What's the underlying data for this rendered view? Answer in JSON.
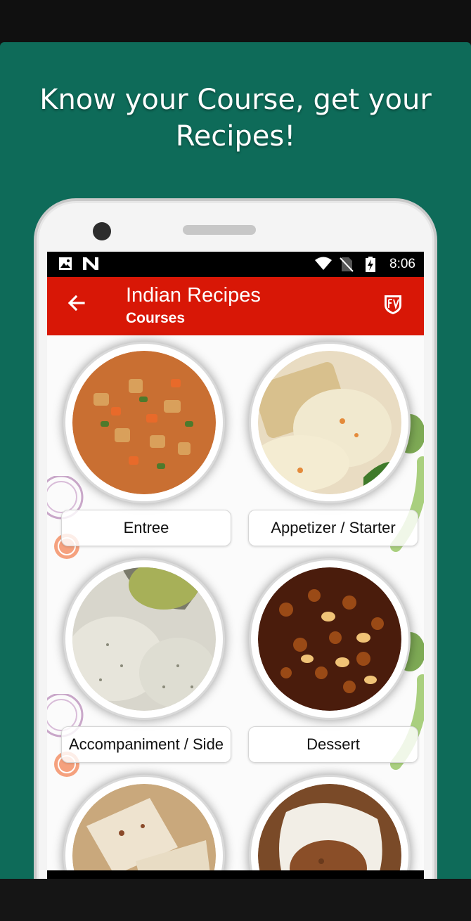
{
  "promo": {
    "headline": "Know your Course, get your Recipes!"
  },
  "statusbar": {
    "icons": [
      "image-icon",
      "n-icon",
      "wifi-icon",
      "no-sim-icon",
      "battery-charging-icon"
    ],
    "time": "8:06"
  },
  "appbar": {
    "title": "Indian Recipes",
    "subtitle": "Courses",
    "back_icon": "arrow-back-icon",
    "brand_icon": "fv-logo-icon",
    "color": "#d81706"
  },
  "courses": [
    {
      "label": "Entree"
    },
    {
      "label": "Appetizer / Starter"
    },
    {
      "label": "Accompaniment / Side"
    },
    {
      "label": "Dessert"
    },
    {
      "label": ""
    },
    {
      "label": ""
    }
  ],
  "colors": {
    "background": "#0e6b59",
    "accent": "#d81706"
  }
}
